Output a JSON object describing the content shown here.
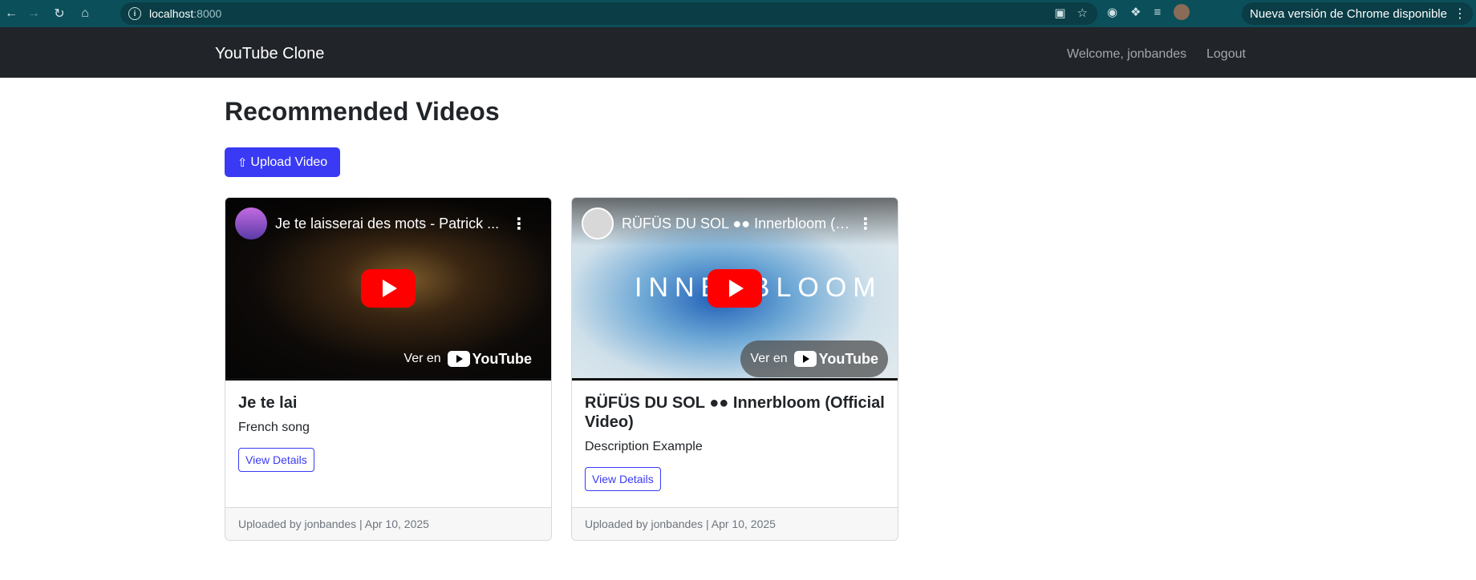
{
  "browser": {
    "url_host": "localhost",
    "url_port": ":8000",
    "update_label": "Nueva versión de Chrome disponible"
  },
  "navbar": {
    "brand": "YouTube Clone",
    "welcome": "Welcome, jonbandes",
    "logout": "Logout"
  },
  "main": {
    "title": "Recommended Videos",
    "upload_label": "Upload Video"
  },
  "videos": [
    {
      "embed_title": "Je te laisserai des mots - Patrick ...",
      "watch_on": "Ver en",
      "yt_brand": "YouTube",
      "title": "Je te lai",
      "description": "French song",
      "details_label": "View Details",
      "footer": "Uploaded by jonbandes | Apr 10, 2025"
    },
    {
      "embed_title": "RÜFÜS DU SOL ●● Innerbloom (O...",
      "overlay_text": "INNERBLOOM",
      "watch_on": "Ver en",
      "yt_brand": "YouTube",
      "title": "RÜFÜS DU SOL ●● Innerbloom (Official Video)",
      "description": "Description Example",
      "details_label": "View Details",
      "footer": "Uploaded by jonbandes | Apr 10, 2025"
    }
  ],
  "colors": {
    "chrome_bar": "#0b4f5a",
    "navbar": "#212529",
    "primary": "#3a3af4",
    "youtube_red": "#ff0000"
  }
}
